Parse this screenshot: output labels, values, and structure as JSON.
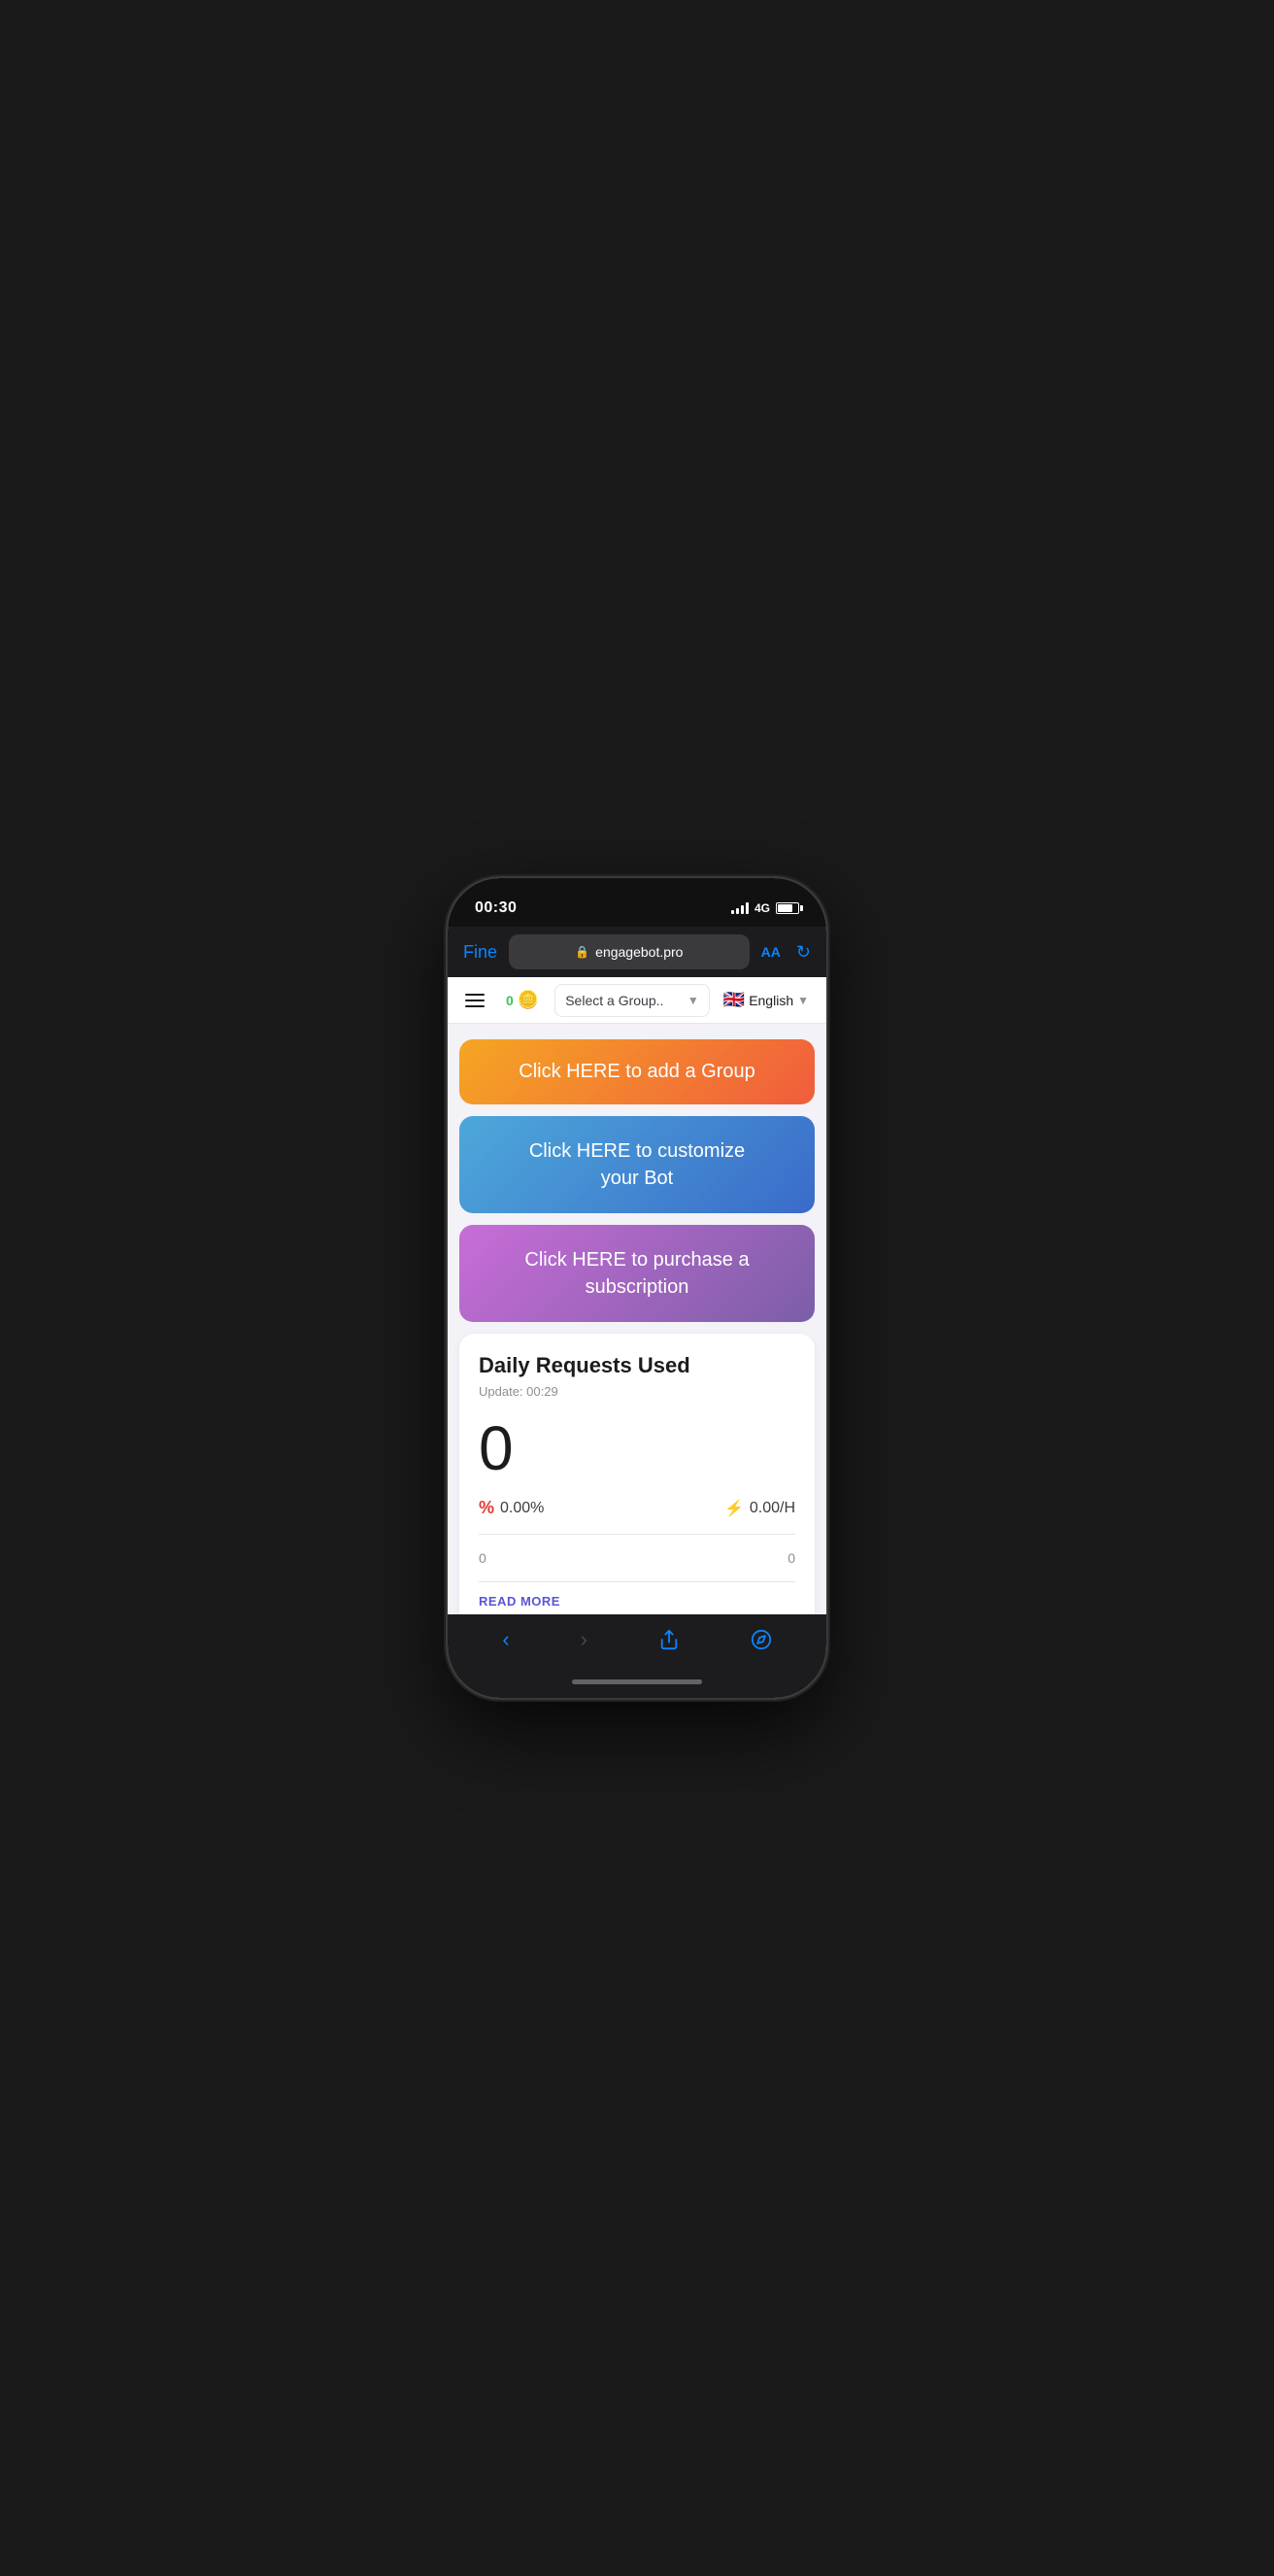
{
  "status_bar": {
    "time": "00:30",
    "network": "4G"
  },
  "browser": {
    "back_label": "Fine",
    "url": "engagebot.pro",
    "aa_label": "AA"
  },
  "nav": {
    "coin_count": "0",
    "group_placeholder": "Select a Group..",
    "language": "English",
    "flag": "🇬🇧"
  },
  "buttons": {
    "add_group": "Click HERE to add a Group",
    "customize_bot": "Click HERE to customize\nyour Bot",
    "subscription": "Click HERE to purchase a\nsubscription"
  },
  "stats": {
    "title": "Daily Requests Used",
    "update_label": "Update: 00:29",
    "count": "0",
    "percent": "0.00%",
    "per_hour": "0.00/H",
    "left_value": "0",
    "right_value": "0",
    "read_more": "READ MORE"
  }
}
